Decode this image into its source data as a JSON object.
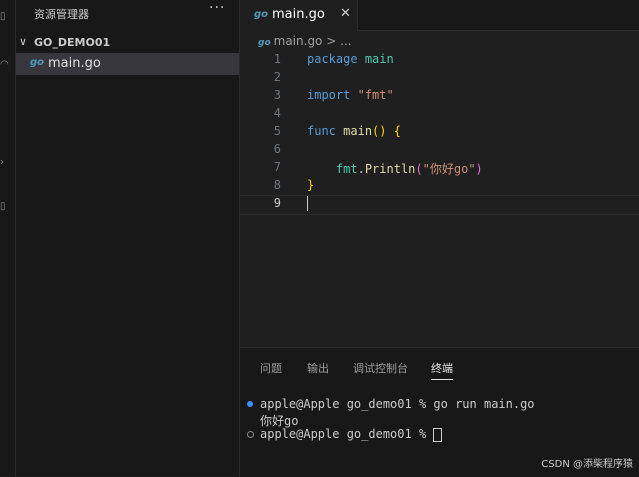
{
  "sidebar": {
    "title": "资源管理器",
    "more": "···",
    "folder_chevron": "∨",
    "folder_name": "GO_DEMO01",
    "file_icon": "go",
    "file_name": "main.go"
  },
  "editor": {
    "tab_icon": "go",
    "tab_label": "main.go",
    "tab_close": "✕",
    "breadcrumb_icon": "go",
    "breadcrumb_file": "main.go",
    "breadcrumb_sep": ">",
    "breadcrumb_more": "...",
    "line_numbers": [
      "1",
      "2",
      "3",
      "4",
      "5",
      "6",
      "7",
      "8",
      "9"
    ],
    "code": {
      "l1_kw": "package",
      "l1_name": "main",
      "l3_kw": "import",
      "l3_str": "\"fmt\"",
      "l5_kw": "func",
      "l5_fn": "main",
      "l5_paren": "()",
      "l5_brace": "{",
      "l7_pkg": "fmt",
      "l7_dot": ".",
      "l7_fn": "Println",
      "l7_open": "(",
      "l7_str": "\"你好go\"",
      "l7_close": ")",
      "l8_brace": "}"
    }
  },
  "panel": {
    "tabs": [
      "问题",
      "输出",
      "调试控制台",
      "终端"
    ],
    "active_tab": "终端",
    "terminal": [
      "apple@Apple go_demo01 % go run main.go",
      "你好go",
      "apple@Apple go_demo01 % "
    ]
  },
  "watermark": "CSDN @添柴程序猿",
  "colors": {
    "accent": "#3794ff",
    "go_icon": "#519aba",
    "keyword": "#569cd6",
    "string": "#ce9178"
  }
}
